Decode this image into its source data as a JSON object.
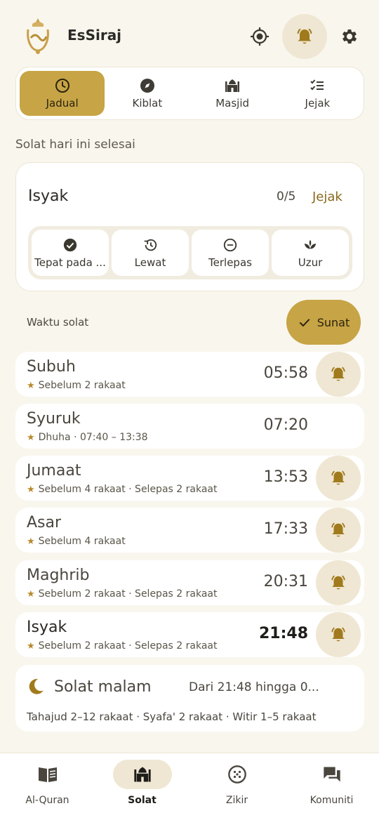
{
  "header": {
    "title": "EsSiraj"
  },
  "tabs": [
    {
      "label": "Jadual",
      "icon": "clock-icon",
      "active": true
    },
    {
      "label": "Kiblat",
      "icon": "compass-icon",
      "active": false
    },
    {
      "label": "Masjid",
      "icon": "mosque-icon",
      "active": false
    },
    {
      "label": "Jejak",
      "icon": "checklist-icon",
      "active": false
    }
  ],
  "summary": {
    "section_label": "Solat hari ini selesai",
    "prayer": "Isyak",
    "count": "0/5",
    "track_link": "Jejak",
    "statuses": [
      {
        "label": "Tepat pada ...",
        "icon": "check-circle-icon"
      },
      {
        "label": "Lewat",
        "icon": "history-icon"
      },
      {
        "label": "Terlepas",
        "icon": "minus-circle-icon"
      },
      {
        "label": "Uzur",
        "icon": "lotus-icon"
      }
    ]
  },
  "waktu": {
    "label": "Waktu solat",
    "sunat_button": "Sunat"
  },
  "prayers": [
    {
      "name": "Subuh",
      "detail": "Sebelum 2 rakaat",
      "time": "05:58",
      "bell": true,
      "current": false
    },
    {
      "name": "Syuruk",
      "detail": "Dhuha · 07:40 – 13:38",
      "time": "07:20",
      "bell": false,
      "current": false
    },
    {
      "name": "Jumaat",
      "detail": "Sebelum 4 rakaat · Selepas 2 rakaat",
      "time": "13:53",
      "bell": true,
      "current": false
    },
    {
      "name": "Asar",
      "detail": "Sebelum 4 rakaat",
      "time": "17:33",
      "bell": true,
      "current": false
    },
    {
      "name": "Maghrib",
      "detail": "Sebelum 2 rakaat · Selepas 2 rakaat",
      "time": "20:31",
      "bell": true,
      "current": false
    },
    {
      "name": "Isyak",
      "detail": "Sebelum 2 rakaat · Selepas 2 rakaat",
      "time": "21:48",
      "bell": true,
      "current": true
    }
  ],
  "night_prayer": {
    "title": "Solat malam",
    "range": "Dari 21:48 hingga 0...",
    "detail": "Tahajud 2–12 rakaat · Syafa' 2 rakaat · Witir 1–5 rakaat"
  },
  "bottom_nav": [
    {
      "label": "Al-Quran",
      "icon": "book-icon",
      "active": false
    },
    {
      "label": "Solat",
      "icon": "mosque-icon",
      "active": true
    },
    {
      "label": "Zikir",
      "icon": "prayer-beads-icon",
      "active": false
    },
    {
      "label": "Komuniti",
      "icon": "chat-icon",
      "active": false
    }
  ],
  "colors": {
    "accent": "#c7a445",
    "accent_light": "#efe7d3",
    "background": "#f9f6ee",
    "icon_gold": "#a07a1c"
  }
}
